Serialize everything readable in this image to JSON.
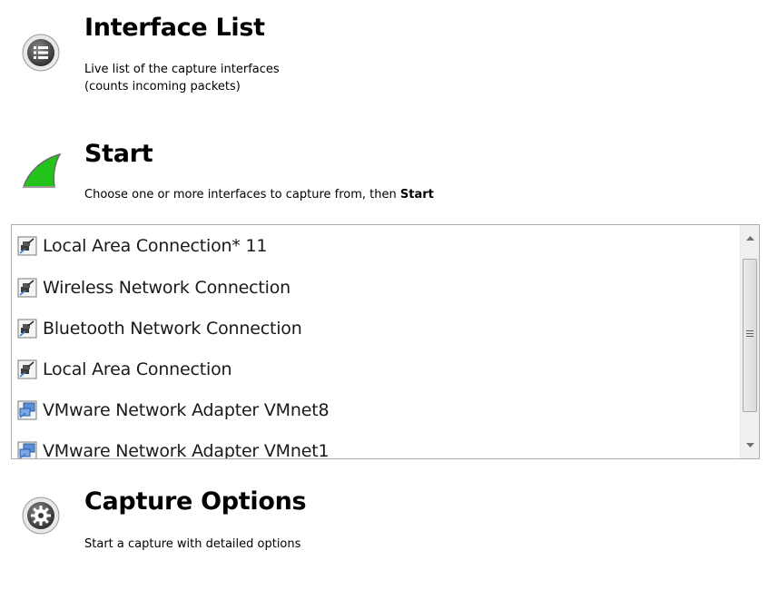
{
  "interface_list": {
    "title": "Interface List",
    "desc_line1": "Live list of the capture interfaces",
    "desc_line2": "(counts incoming packets)",
    "icon": "list-icon"
  },
  "start": {
    "title": "Start",
    "desc_prefix": "Choose one or more interfaces to capture from, then ",
    "desc_bold": "Start",
    "icon": "shark-fin-icon",
    "icon_color": "#22c41a"
  },
  "interfaces": [
    {
      "label": "Local Area Connection* 11",
      "icon": "network-adapter-icon"
    },
    {
      "label": "Wireless Network Connection",
      "icon": "network-adapter-icon"
    },
    {
      "label": "Bluetooth Network Connection",
      "icon": "network-adapter-icon"
    },
    {
      "label": "Local Area Connection",
      "icon": "network-adapter-icon"
    },
    {
      "label": "VMware Network Adapter VMnet8",
      "icon": "virtual-network-adapter-icon"
    },
    {
      "label": "VMware Network Adapter VMnet1",
      "icon": "virtual-network-adapter-icon"
    }
  ],
  "capture_options": {
    "title": "Capture Options",
    "desc": "Start a capture with detailed options",
    "icon": "gear-icon"
  }
}
